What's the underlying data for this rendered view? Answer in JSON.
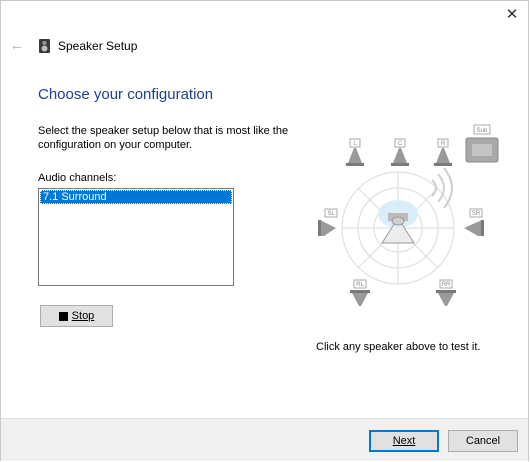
{
  "window": {
    "title": "Speaker Setup",
    "close_glyph": "✕",
    "back_glyph": "←"
  },
  "page": {
    "heading": "Choose your configuration",
    "description": "Select the speaker setup below that is most like the configuration on your computer.",
    "list_label": "Audio channels:",
    "list_items": [
      "7.1 Surround"
    ],
    "selected_item": "7.1 Surround",
    "stop_button": "Stop",
    "hint": "Click any speaker above to test it."
  },
  "speakers": {
    "front_left": "L",
    "center": "C",
    "front_right": "R",
    "subwoofer": "Sub",
    "side_left": "SL",
    "side_right": "SR",
    "rear_left": "RL",
    "rear_right": "RR"
  },
  "footer": {
    "next_label": "Next",
    "cancel_label": "Cancel"
  },
  "colors": {
    "heading": "#1f3f8f",
    "selection": "#0078d7",
    "footer_bg": "#f0f0f0"
  }
}
